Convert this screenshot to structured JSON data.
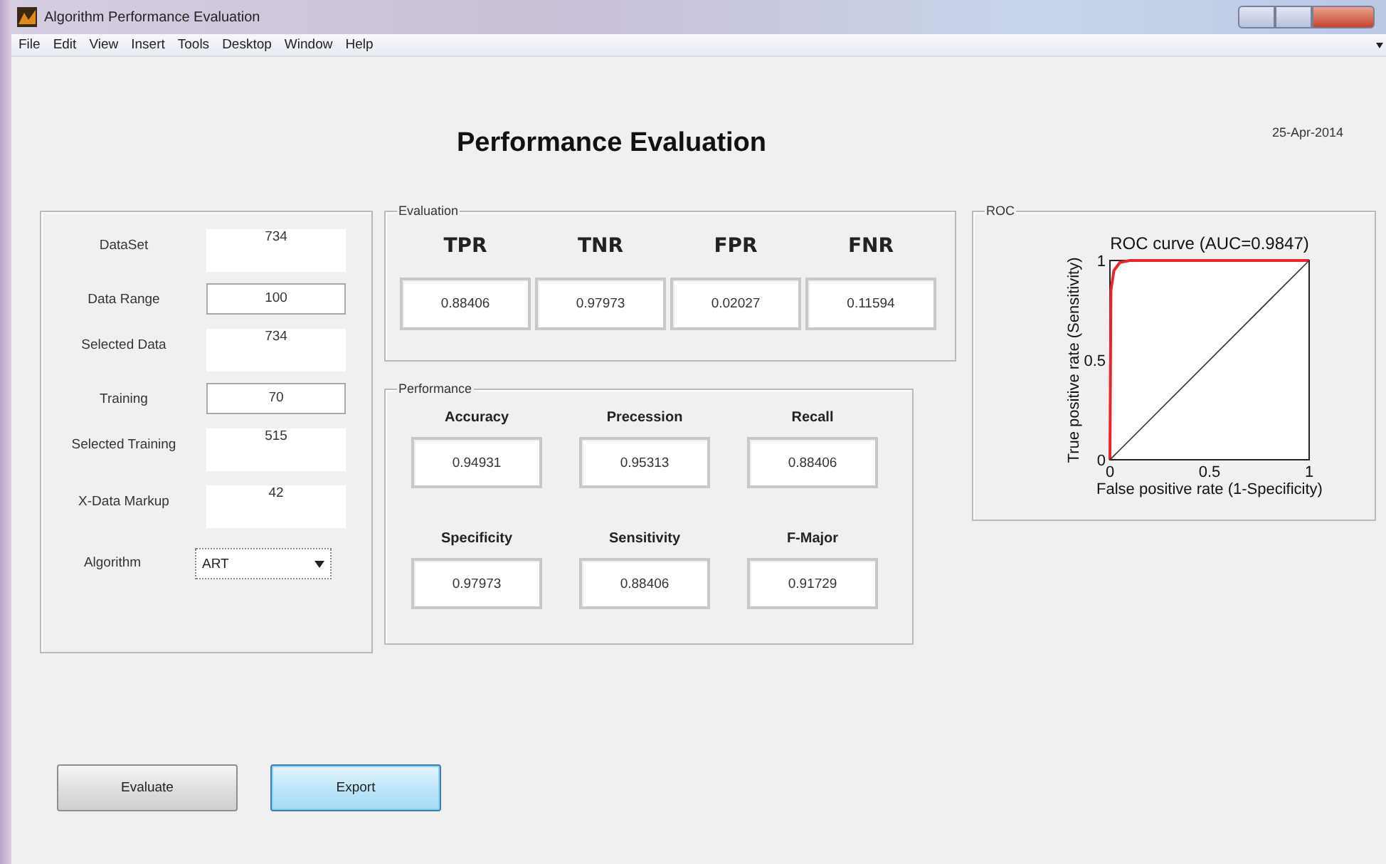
{
  "window": {
    "title": "Algorithm Performance Evaluation"
  },
  "menu": [
    "File",
    "Edit",
    "View",
    "Insert",
    "Tools",
    "Desktop",
    "Window",
    "Help"
  ],
  "heading": "Performance Evaluation",
  "date": "25-Apr-2014",
  "inputs": [
    {
      "label": "DataSet",
      "value": "734",
      "kind": "static"
    },
    {
      "label": "Data Range",
      "value": "100",
      "kind": "edit"
    },
    {
      "label": "Selected Data",
      "value": "734",
      "kind": "static"
    },
    {
      "label": "Training",
      "value": "70",
      "kind": "edit"
    },
    {
      "label": "Selected Training",
      "value": "515",
      "kind": "static"
    },
    {
      "label": "X-Data Markup",
      "value": "42",
      "kind": "static"
    },
    {
      "label": "Algorithm",
      "value": "ART",
      "kind": "dropdown"
    }
  ],
  "evaluation": {
    "title": "Evaluation",
    "metrics": [
      {
        "label": "TPR",
        "value": "0.88406"
      },
      {
        "label": "TNR",
        "value": "0.97973"
      },
      {
        "label": "FPR",
        "value": "0.02027"
      },
      {
        "label": "FNR",
        "value": "0.11594"
      }
    ]
  },
  "performance": {
    "title": "Performance",
    "metrics": [
      {
        "label": "Accuracy",
        "value": "0.94931"
      },
      {
        "label": "Precession",
        "value": "0.95313"
      },
      {
        "label": "Recall",
        "value": "0.88406"
      },
      {
        "label": "Specificity",
        "value": "0.97973"
      },
      {
        "label": "Sensitivity",
        "value": "0.88406"
      },
      {
        "label": "F-Major",
        "value": "0.91729"
      }
    ]
  },
  "roc": {
    "title": "ROC",
    "chart_data": {
      "type": "line",
      "title": "ROC curve (AUC=0.9847)",
      "xlabel": "False positive rate (1-Specificity)",
      "ylabel": "True positive rate (Sensitivity)",
      "x": [
        0,
        0.005,
        0.02,
        0.05,
        0.1,
        1
      ],
      "xlim": [
        0,
        1
      ],
      "ylim": [
        0,
        1
      ],
      "xticks": [
        0,
        0.5,
        1
      ],
      "yticks": [
        0,
        0.5,
        1
      ],
      "series": [
        {
          "color": "#e8262a",
          "values": [
            0,
            0.85,
            0.95,
            0.99,
            1,
            1
          ]
        },
        {
          "color": "#333333",
          "values": [
            0,
            0.005,
            0.02,
            0.05,
            0.1,
            1
          ]
        }
      ]
    }
  },
  "buttons": [
    {
      "label": "Evaluate",
      "focused": false
    },
    {
      "label": "Export",
      "focused": true
    }
  ]
}
